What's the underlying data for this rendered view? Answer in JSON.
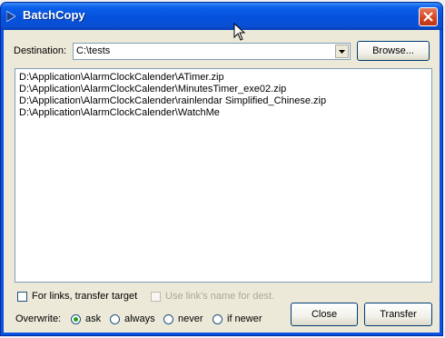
{
  "window": {
    "title": "BatchCopy",
    "icons": {
      "app": "batchcopy-app-icon",
      "close": "close-icon"
    },
    "accent": "#0a53e1"
  },
  "destination": {
    "label": "Destination:",
    "value": "C:\\tests",
    "dropdown_icon": "chevron-down-icon",
    "browse_label": "Browse..."
  },
  "files": [
    "D:\\Application\\AlarmClockCalender\\ATimer.zip",
    "D:\\Application\\AlarmClockCalender\\MinutesTimer_exe02.zip",
    "D:\\Application\\AlarmClockCalender\\rainlendar Simplified_Chinese.zip",
    "D:\\Application\\AlarmClockCalender\\WatchMe"
  ],
  "options": {
    "links_label": "For links, transfer target",
    "links_checked": false,
    "use_name_label": "Use link's name for dest.",
    "use_name_checked": false,
    "use_name_enabled": false
  },
  "overwrite": {
    "label": "Overwrite:",
    "choices": [
      "ask",
      "always",
      "never",
      "if newer"
    ],
    "selected": "ask"
  },
  "buttons": {
    "close_label": "Close",
    "transfer_label": "Transfer"
  }
}
